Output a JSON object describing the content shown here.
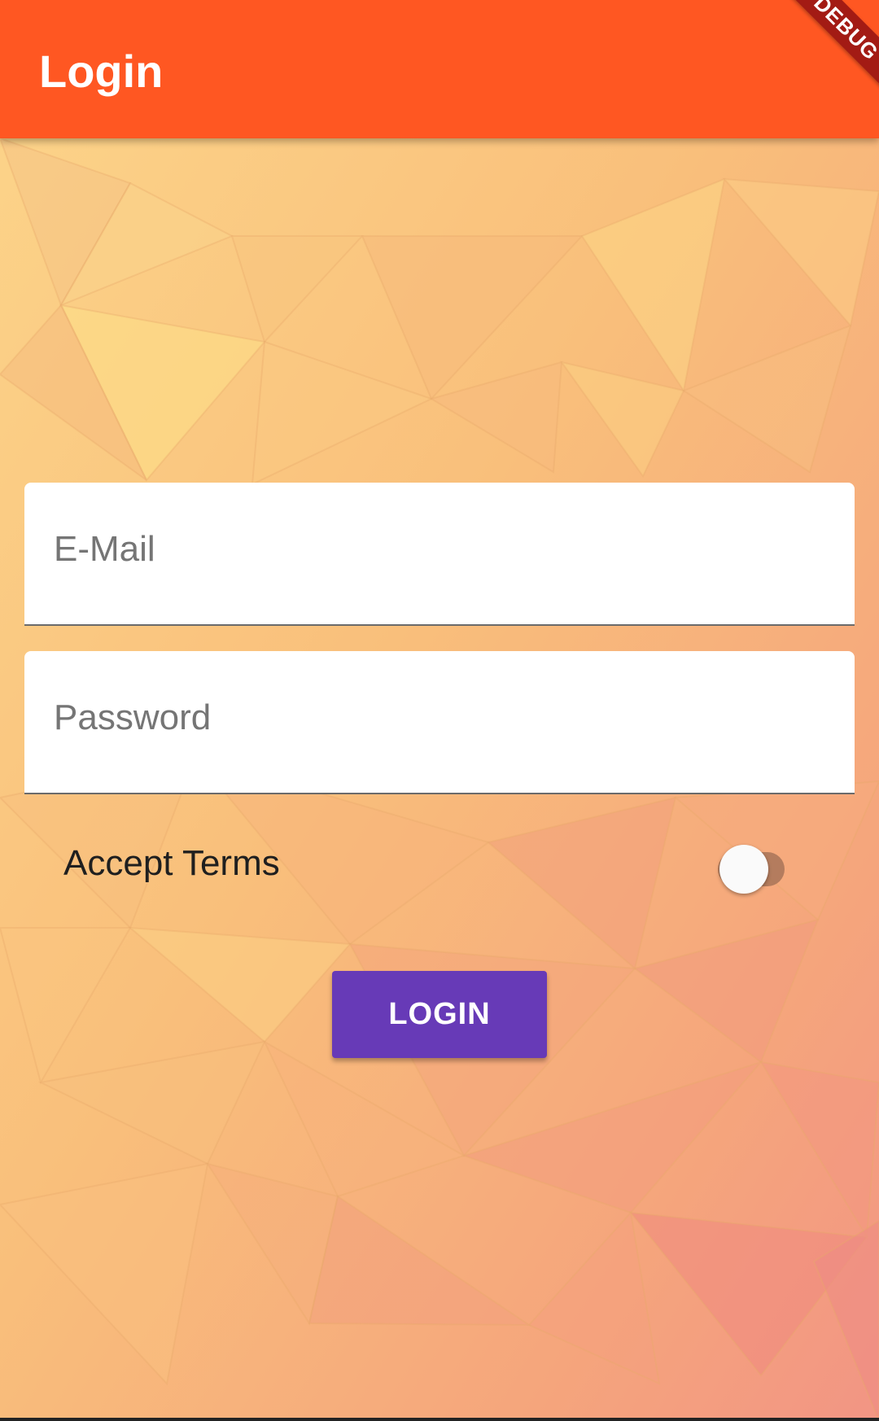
{
  "app_bar": {
    "title": "Login",
    "color": "#ff5722"
  },
  "debug_banner": {
    "label": "DEBUG"
  },
  "form": {
    "email": {
      "placeholder": "E-Mail",
      "value": ""
    },
    "password": {
      "placeholder": "Password",
      "value": ""
    },
    "terms": {
      "label": "Accept Terms",
      "accepted": false
    },
    "login_button": {
      "label": "LOGIN",
      "color": "#673ab7"
    }
  },
  "background": {
    "style": "low-poly triangles",
    "colors": [
      "#fcd97f",
      "#f9c27a",
      "#f5a97c",
      "#f29080"
    ]
  }
}
